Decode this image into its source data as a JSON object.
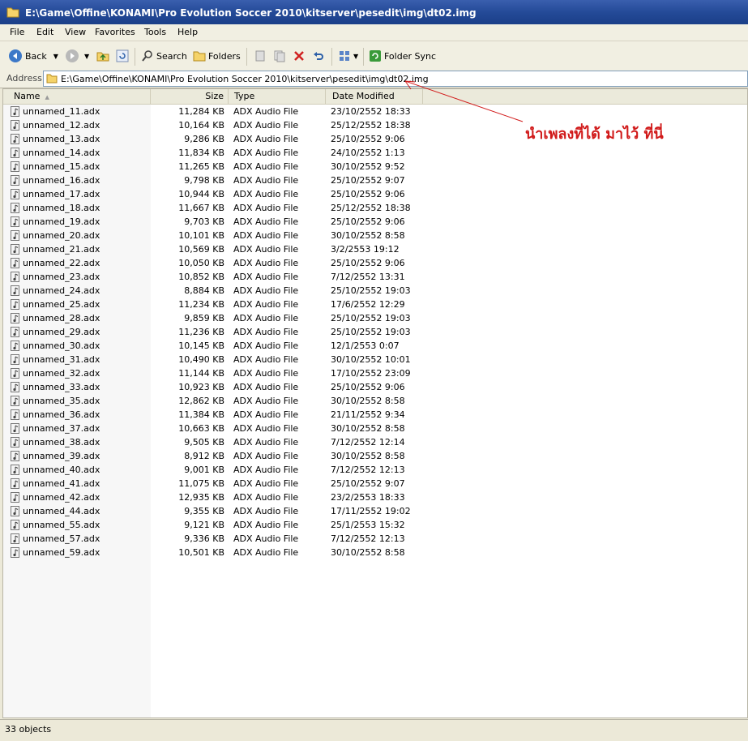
{
  "window": {
    "title": "E:\\Game\\Offine\\KONAMI\\Pro Evolution Soccer 2010\\kitserver\\pesedit\\img\\dt02.img"
  },
  "menu": [
    "File",
    "Edit",
    "View",
    "Favorites",
    "Tools",
    "Help"
  ],
  "toolbar": {
    "back": "Back",
    "search": "Search",
    "folders": "Folders",
    "folder_sync": "Folder Sync"
  },
  "address": {
    "label": "Address",
    "value": "E:\\Game\\Offine\\KONAMI\\Pro Evolution Soccer 2010\\kitserver\\pesedit\\img\\dt02.img"
  },
  "columns": {
    "name": "Name",
    "size": "Size",
    "type": "Type",
    "date": "Date Modified"
  },
  "files": [
    {
      "name": "unnamed_11.adx",
      "size": "11,284 KB",
      "type": "ADX Audio File",
      "date": "23/10/2552 18:33"
    },
    {
      "name": "unnamed_12.adx",
      "size": "10,164 KB",
      "type": "ADX Audio File",
      "date": "25/12/2552 18:38"
    },
    {
      "name": "unnamed_13.adx",
      "size": "9,286 KB",
      "type": "ADX Audio File",
      "date": "25/10/2552 9:06"
    },
    {
      "name": "unnamed_14.adx",
      "size": "11,834 KB",
      "type": "ADX Audio File",
      "date": "24/10/2552 1:13"
    },
    {
      "name": "unnamed_15.adx",
      "size": "11,265 KB",
      "type": "ADX Audio File",
      "date": "30/10/2552 9:52"
    },
    {
      "name": "unnamed_16.adx",
      "size": "9,798 KB",
      "type": "ADX Audio File",
      "date": "25/10/2552 9:07"
    },
    {
      "name": "unnamed_17.adx",
      "size": "10,944 KB",
      "type": "ADX Audio File",
      "date": "25/10/2552 9:06"
    },
    {
      "name": "unnamed_18.adx",
      "size": "11,667 KB",
      "type": "ADX Audio File",
      "date": "25/12/2552 18:38"
    },
    {
      "name": "unnamed_19.adx",
      "size": "9,703 KB",
      "type": "ADX Audio File",
      "date": "25/10/2552 9:06"
    },
    {
      "name": "unnamed_20.adx",
      "size": "10,101 KB",
      "type": "ADX Audio File",
      "date": "30/10/2552 8:58"
    },
    {
      "name": "unnamed_21.adx",
      "size": "10,569 KB",
      "type": "ADX Audio File",
      "date": "3/2/2553 19:12"
    },
    {
      "name": "unnamed_22.adx",
      "size": "10,050 KB",
      "type": "ADX Audio File",
      "date": "25/10/2552 9:06"
    },
    {
      "name": "unnamed_23.adx",
      "size": "10,852 KB",
      "type": "ADX Audio File",
      "date": "7/12/2552 13:31"
    },
    {
      "name": "unnamed_24.adx",
      "size": "8,884 KB",
      "type": "ADX Audio File",
      "date": "25/10/2552 19:03"
    },
    {
      "name": "unnamed_25.adx",
      "size": "11,234 KB",
      "type": "ADX Audio File",
      "date": "17/6/2552 12:29"
    },
    {
      "name": "unnamed_28.adx",
      "size": "9,859 KB",
      "type": "ADX Audio File",
      "date": "25/10/2552 19:03"
    },
    {
      "name": "unnamed_29.adx",
      "size": "11,236 KB",
      "type": "ADX Audio File",
      "date": "25/10/2552 19:03"
    },
    {
      "name": "unnamed_30.adx",
      "size": "10,145 KB",
      "type": "ADX Audio File",
      "date": "12/1/2553 0:07"
    },
    {
      "name": "unnamed_31.adx",
      "size": "10,490 KB",
      "type": "ADX Audio File",
      "date": "30/10/2552 10:01"
    },
    {
      "name": "unnamed_32.adx",
      "size": "11,144 KB",
      "type": "ADX Audio File",
      "date": "17/10/2552 23:09"
    },
    {
      "name": "unnamed_33.adx",
      "size": "10,923 KB",
      "type": "ADX Audio File",
      "date": "25/10/2552 9:06"
    },
    {
      "name": "unnamed_35.adx",
      "size": "12,862 KB",
      "type": "ADX Audio File",
      "date": "30/10/2552 8:58"
    },
    {
      "name": "unnamed_36.adx",
      "size": "11,384 KB",
      "type": "ADX Audio File",
      "date": "21/11/2552 9:34"
    },
    {
      "name": "unnamed_37.adx",
      "size": "10,663 KB",
      "type": "ADX Audio File",
      "date": "30/10/2552 8:58"
    },
    {
      "name": "unnamed_38.adx",
      "size": "9,505 KB",
      "type": "ADX Audio File",
      "date": "7/12/2552 12:14"
    },
    {
      "name": "unnamed_39.adx",
      "size": "8,912 KB",
      "type": "ADX Audio File",
      "date": "30/10/2552 8:58"
    },
    {
      "name": "unnamed_40.adx",
      "size": "9,001 KB",
      "type": "ADX Audio File",
      "date": "7/12/2552 12:13"
    },
    {
      "name": "unnamed_41.adx",
      "size": "11,075 KB",
      "type": "ADX Audio File",
      "date": "25/10/2552 9:07"
    },
    {
      "name": "unnamed_42.adx",
      "size": "12,935 KB",
      "type": "ADX Audio File",
      "date": "23/2/2553 18:33"
    },
    {
      "name": "unnamed_44.adx",
      "size": "9,355 KB",
      "type": "ADX Audio File",
      "date": "17/11/2552 19:02"
    },
    {
      "name": "unnamed_55.adx",
      "size": "9,121 KB",
      "type": "ADX Audio File",
      "date": "25/1/2553 15:32"
    },
    {
      "name": "unnamed_57.adx",
      "size": "9,336 KB",
      "type": "ADX Audio File",
      "date": "7/12/2552 12:13"
    },
    {
      "name": "unnamed_59.adx",
      "size": "10,501 KB",
      "type": "ADX Audio File",
      "date": "30/10/2552 8:58"
    }
  ],
  "status": {
    "text": "33 objects"
  },
  "annotation": {
    "text": "นำเพลงที่ได้ มาไว้ ที่นี่",
    "color": "#d11a1a"
  }
}
